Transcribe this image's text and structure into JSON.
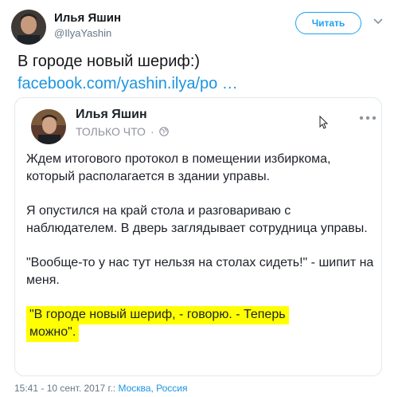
{
  "author": {
    "name": "Илья Яшин",
    "handle": "@IlyaYashin"
  },
  "follow_button": {
    "label": "Читать"
  },
  "tweet": {
    "text": "В городе новый шериф:)",
    "link_text": "facebook.com/yashin.ilya/po …"
  },
  "embedded_post": {
    "name": "Илья Яшин",
    "time": "ТОЛЬКО ЧТО",
    "separator": "·",
    "paragraphs": [
      "Ждем итогового протокол в помещении избиркома, который располагается в здании управы.",
      "Я опустился на край стола и разговариваю с наблюдателем. В дверь заглядывает сотрудница управы.",
      "\"Вообще-то у нас тут нельзя на столах сидеть!\" - шипит на меня."
    ],
    "highlight_line1": "\"В городе новый шериф, - говорю. - Теперь",
    "highlight_line2": "можно\".",
    "highlight_color": "#ffff00"
  },
  "footer": {
    "timestamp": "15:41 - 10 сент. 2017 г.:",
    "location": "Москва, Россия"
  },
  "colors": {
    "accent": "#1da1f2",
    "link": "#1b95e0",
    "muted": "#657786"
  }
}
